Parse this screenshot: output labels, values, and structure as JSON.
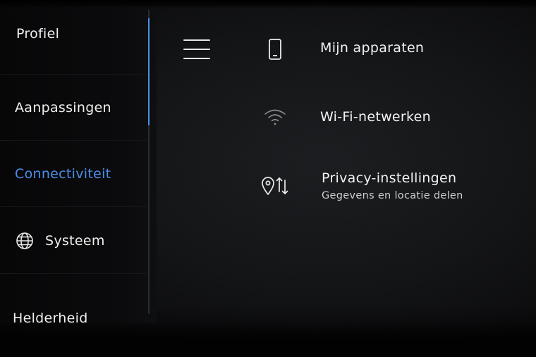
{
  "sidebar": {
    "items": [
      {
        "label": "Profiel",
        "active": false
      },
      {
        "label": "Aanpassingen",
        "active": false
      },
      {
        "label": "Connectiviteit",
        "active": true
      },
      {
        "label": "Systeem",
        "active": false,
        "icon": "globe-icon"
      },
      {
        "label": "Helderheid",
        "active": false
      }
    ]
  },
  "menu": {
    "icon": "hamburger-menu-icon"
  },
  "settings": {
    "rows": [
      {
        "title": "Mijn apparaten",
        "icon": "smartphone-icon"
      },
      {
        "title": "Wi-Fi-netwerken",
        "icon": "wifi-icon"
      },
      {
        "title": "Privacy-instellingen",
        "subtitle": "Gegevens en locatie delen",
        "icon": "location-sharing-icon"
      }
    ]
  },
  "colors": {
    "accent": "#4a8fe8",
    "background": "#131416",
    "text": "#efefef"
  }
}
